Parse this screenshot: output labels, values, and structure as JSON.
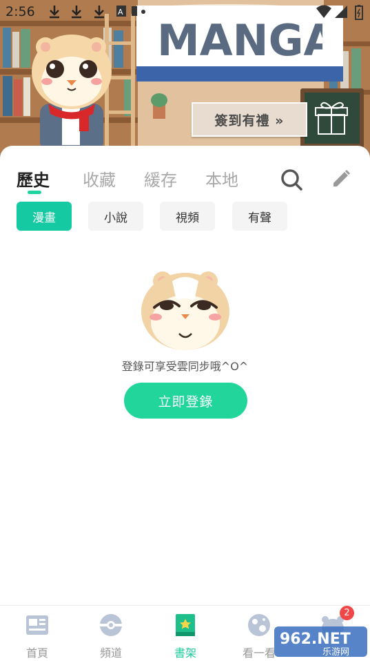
{
  "status_bar": {
    "time": "2:56",
    "icons": [
      "download-icon",
      "download-icon",
      "download-icon",
      "app-icon",
      "sim-icon",
      "dot-icon",
      "wifi-icon",
      "signal-icon",
      "battery-icon"
    ]
  },
  "banner": {
    "title": "MANGA",
    "sign_in_label": "簽到有禮 »",
    "icons": [
      "hamster-mascot",
      "gift-box-icon"
    ]
  },
  "tabs": [
    {
      "label": "歷史",
      "active": true
    },
    {
      "label": "收藏",
      "active": false
    },
    {
      "label": "緩存",
      "active": false
    },
    {
      "label": "本地",
      "active": false
    }
  ],
  "toolbar_icons": [
    "search-icon",
    "edit-pencil-icon"
  ],
  "chips": [
    {
      "label": "漫畫",
      "active": true
    },
    {
      "label": "小說",
      "active": false
    },
    {
      "label": "視頻",
      "active": false
    },
    {
      "label": "有聲",
      "active": false
    }
  ],
  "empty_state": {
    "message": "登錄可享受雲同步哦^O^",
    "button_label": "立即登錄"
  },
  "bottom_nav": [
    {
      "label": "首頁",
      "icon": "home-newspaper-icon",
      "active": false
    },
    {
      "label": "頻道",
      "icon": "channel-icon",
      "active": false
    },
    {
      "label": "書架",
      "icon": "bookshelf-icon",
      "active": true
    },
    {
      "label": "看一看",
      "icon": "planet-icon",
      "active": false
    },
    {
      "label": "",
      "icon": "profile-mascot-icon",
      "active": false
    }
  ],
  "nav_badge": "2",
  "watermark": {
    "text_main": "962.NET",
    "text_sub": "乐游网"
  },
  "colors": {
    "accent": "#1fd3a1",
    "chip_active": "#15c9a2",
    "button": "#22d59a",
    "badge": "#f04848"
  }
}
